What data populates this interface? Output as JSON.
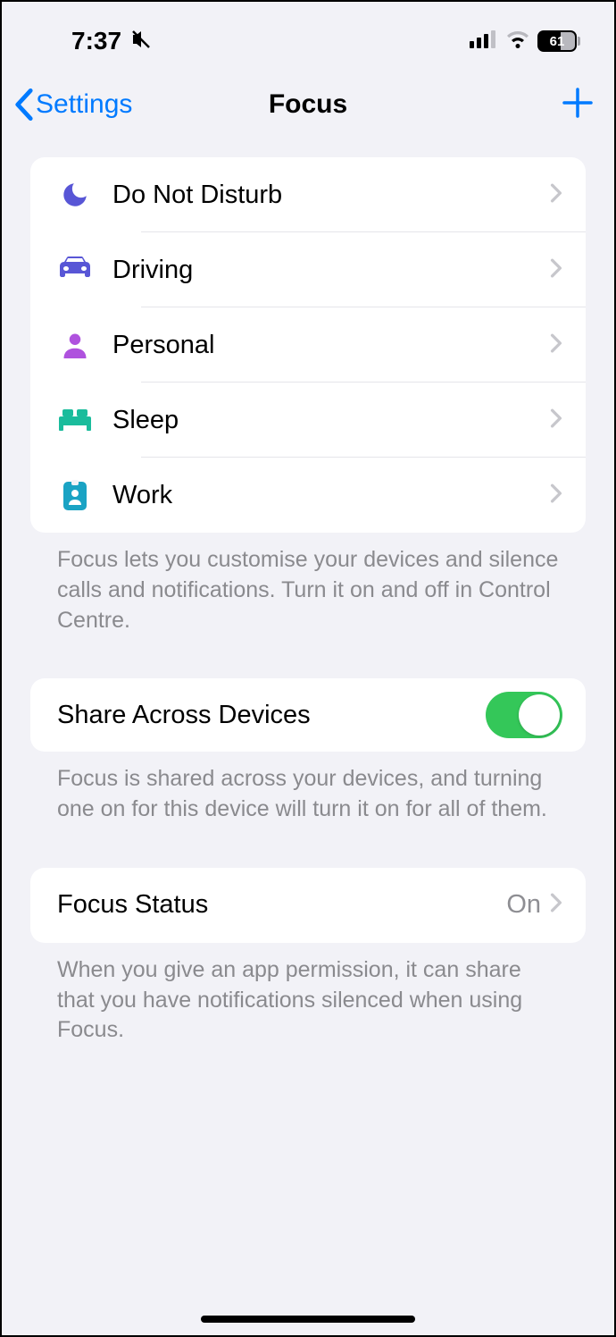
{
  "status": {
    "time": "7:37",
    "battery": "61"
  },
  "nav": {
    "back": "Settings",
    "title": "Focus"
  },
  "focus_modes": [
    {
      "label": "Do Not Disturb",
      "icon": "moon",
      "color": "#5856d6"
    },
    {
      "label": "Driving",
      "icon": "car",
      "color": "#5856d6"
    },
    {
      "label": "Personal",
      "icon": "person",
      "color": "#af52de"
    },
    {
      "label": "Sleep",
      "icon": "bed",
      "color": "#1abc9c"
    },
    {
      "label": "Work",
      "icon": "badge",
      "color": "#1aa3c4"
    }
  ],
  "footers": {
    "modes": "Focus lets you customise your devices and silence calls and notifications. Turn it on and off in Control Centre.",
    "share": "Focus is shared across your devices, and turning one on for this device will turn it on for all of them.",
    "status": "When you give an app permission, it can share that you have notifications silenced when using Focus."
  },
  "share": {
    "label": "Share Across Devices",
    "on": true
  },
  "focus_status": {
    "label": "Focus Status",
    "value": "On"
  }
}
